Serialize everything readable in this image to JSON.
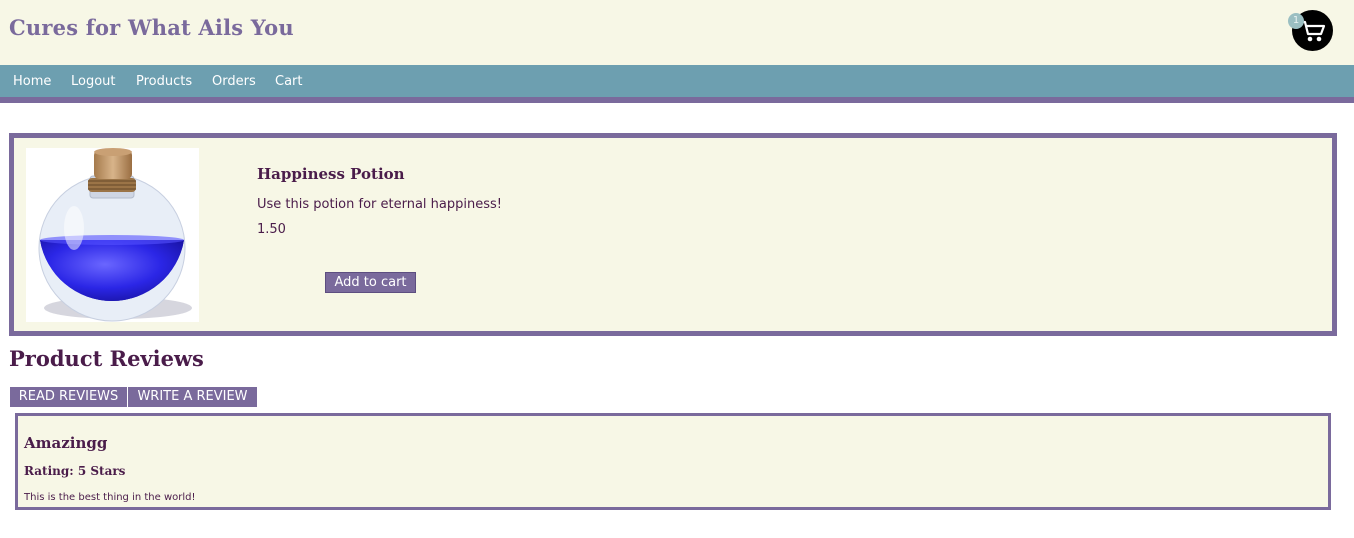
{
  "header": {
    "site_title": "Cures for What Ails You",
    "cart_count": "1"
  },
  "nav": {
    "items": [
      {
        "label": "Home"
      },
      {
        "label": "Logout"
      },
      {
        "label": "Products"
      },
      {
        "label": "Orders"
      },
      {
        "label": "Cart"
      }
    ]
  },
  "product": {
    "name": "Happiness Potion",
    "description": "Use this potion for eternal happiness!",
    "price": "1.50",
    "add_to_cart_label": "Add to cart",
    "image_icon": "blue-potion-bottle-image"
  },
  "reviews": {
    "heading": "Product Reviews",
    "tabs": [
      {
        "label": "READ REVIEWS"
      },
      {
        "label": "WRITE A REVIEW"
      }
    ],
    "items": [
      {
        "title": "Amazingg",
        "rating": "Rating: 5 Stars",
        "text": "This is the best thing in the world!"
      }
    ]
  },
  "colors": {
    "header_bg": "#f7f7e6",
    "nav_bg": "#6d9fb0",
    "accent_purple": "#7a6a9c",
    "text_dark": "#4a1c4a"
  }
}
